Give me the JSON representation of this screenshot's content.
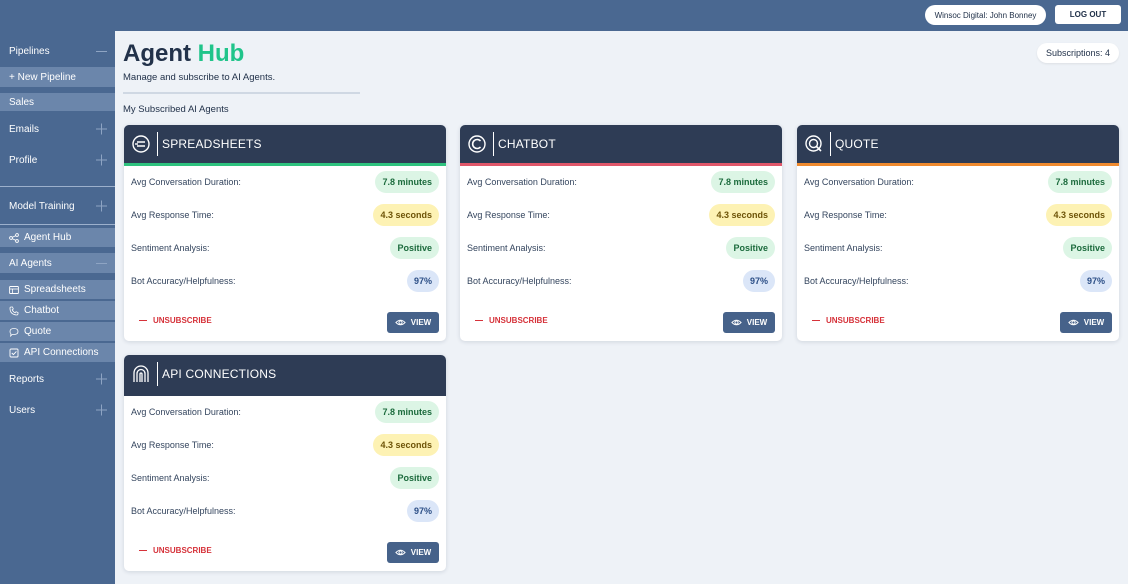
{
  "header": {
    "user_label": "Winsoc Digital: John Bonney",
    "logout_label": "LOG OUT"
  },
  "sidebar": {
    "pipelines": "Pipelines",
    "new_pipeline": "+ New Pipeline",
    "sales": "Sales",
    "emails": "Emails",
    "profile": "Profile",
    "model_training": "Model Training",
    "agent_hub": "Agent Hub",
    "ai_agents": "AI Agents",
    "agents": [
      {
        "label": "Spreadsheets",
        "icon": "spreadsheet-icon"
      },
      {
        "label": "Chatbot",
        "icon": "phone-icon"
      },
      {
        "label": "Quote",
        "icon": "quote-icon"
      },
      {
        "label": "API Connections",
        "icon": "checkbox-icon"
      }
    ],
    "reports": "Reports",
    "users": "Users"
  },
  "main": {
    "title_prefix": "Agent",
    "title_highlight": "Hub",
    "subtitle": "Manage and subscribe to AI Agents.",
    "subscriptions": "Subscriptions: 4",
    "section_label": "My Subscribed AI Agents"
  },
  "labels": {
    "duration": "Avg Conversation Duration:",
    "response": "Avg Response Time:",
    "sentiment": "Sentiment Analysis:",
    "accuracy": "Bot Accuracy/Helpfulness:",
    "unsubscribe": "UNSUBSCRIBE",
    "view": "VIEW"
  },
  "cards": [
    {
      "name": "SPREADSHEETS",
      "icon": "spreadsheet-agent-icon",
      "accent": "#2ec27e",
      "duration": "7.8 minutes",
      "response": "4.3 seconds",
      "sentiment": "Positive",
      "accuracy": "97%"
    },
    {
      "name": "CHATBOT",
      "icon": "chatbot-agent-icon",
      "accent": "#e0576a",
      "duration": "7.8 minutes",
      "response": "4.3 seconds",
      "sentiment": "Positive",
      "accuracy": "97%"
    },
    {
      "name": "QUOTE",
      "icon": "quote-agent-icon",
      "accent": "#ef8a2e",
      "duration": "7.8 minutes",
      "response": "4.3 seconds",
      "sentiment": "Positive",
      "accuracy": "97%"
    },
    {
      "name": "API CONNECTIONS",
      "icon": "api-agent-icon",
      "accent": "#2e3c55",
      "duration": "7.8 minutes",
      "response": "4.3 seconds",
      "sentiment": "Positive",
      "accuracy": "97%"
    }
  ],
  "colors": {
    "sidebar": "#4a6891",
    "sidebar_active": "#6b86ab",
    "card_header": "#2e3c55",
    "brand_green": "#20c48a",
    "danger": "#d6323a"
  }
}
